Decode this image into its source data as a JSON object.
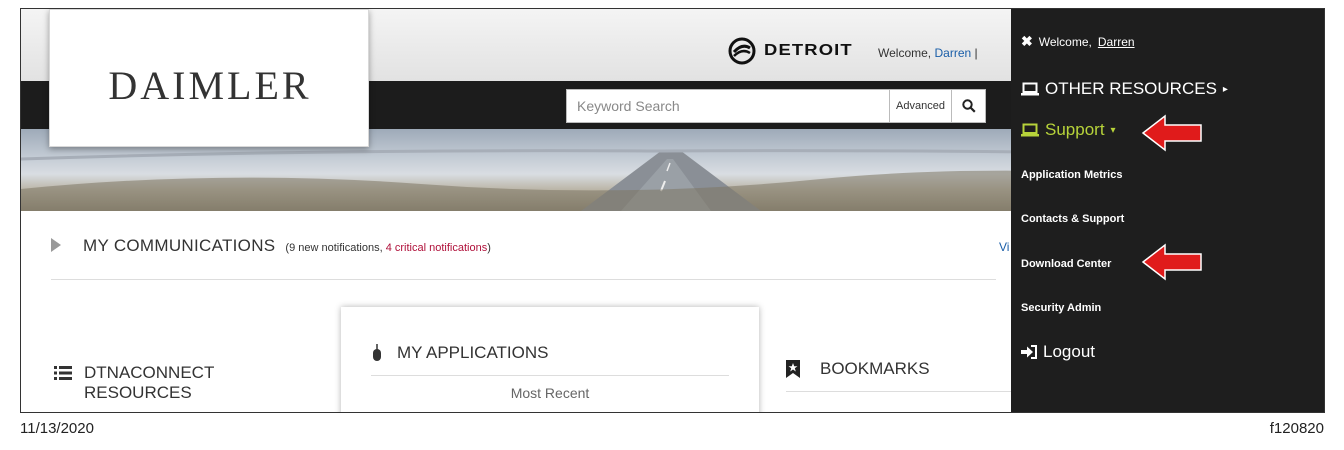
{
  "brand": {
    "daimler": "DAIMLER",
    "detroit": "DETROIT"
  },
  "header": {
    "welcome_prefix": "Welcome,",
    "user_name": "Darren",
    "separator": "|"
  },
  "search": {
    "placeholder": "Keyword Search",
    "advanced_label": "Advanced"
  },
  "communications": {
    "title": "MY COMMUNICATIONS",
    "note_open": "(",
    "note_text": "9 new notifications, ",
    "critical_text": "4 critical notifications",
    "note_close": ")",
    "view_link": "Vi"
  },
  "resources": {
    "title_line1": "DTNACONNECT",
    "title_line2": "RESOURCES"
  },
  "applications": {
    "title": "MY APPLICATIONS",
    "recent_label": "Most Recent"
  },
  "bookmarks": {
    "title": "BOOKMARKS"
  },
  "menu": {
    "welcome_prefix": "Welcome,",
    "user_name": "Darren",
    "other_resources": "OTHER RESOURCES",
    "support": "Support",
    "items": [
      "Application Metrics",
      "Contacts & Support",
      "Download Center",
      "Security Admin"
    ],
    "logout": "Logout"
  },
  "footer": {
    "date": "11/13/2020",
    "figure_id": "f120820"
  },
  "colors": {
    "menu_bg": "#1e1e1e",
    "support_accent": "#b7d33a",
    "critical": "#b0103a",
    "link": "#1a5ea8",
    "arrow": "#e01b1b"
  }
}
